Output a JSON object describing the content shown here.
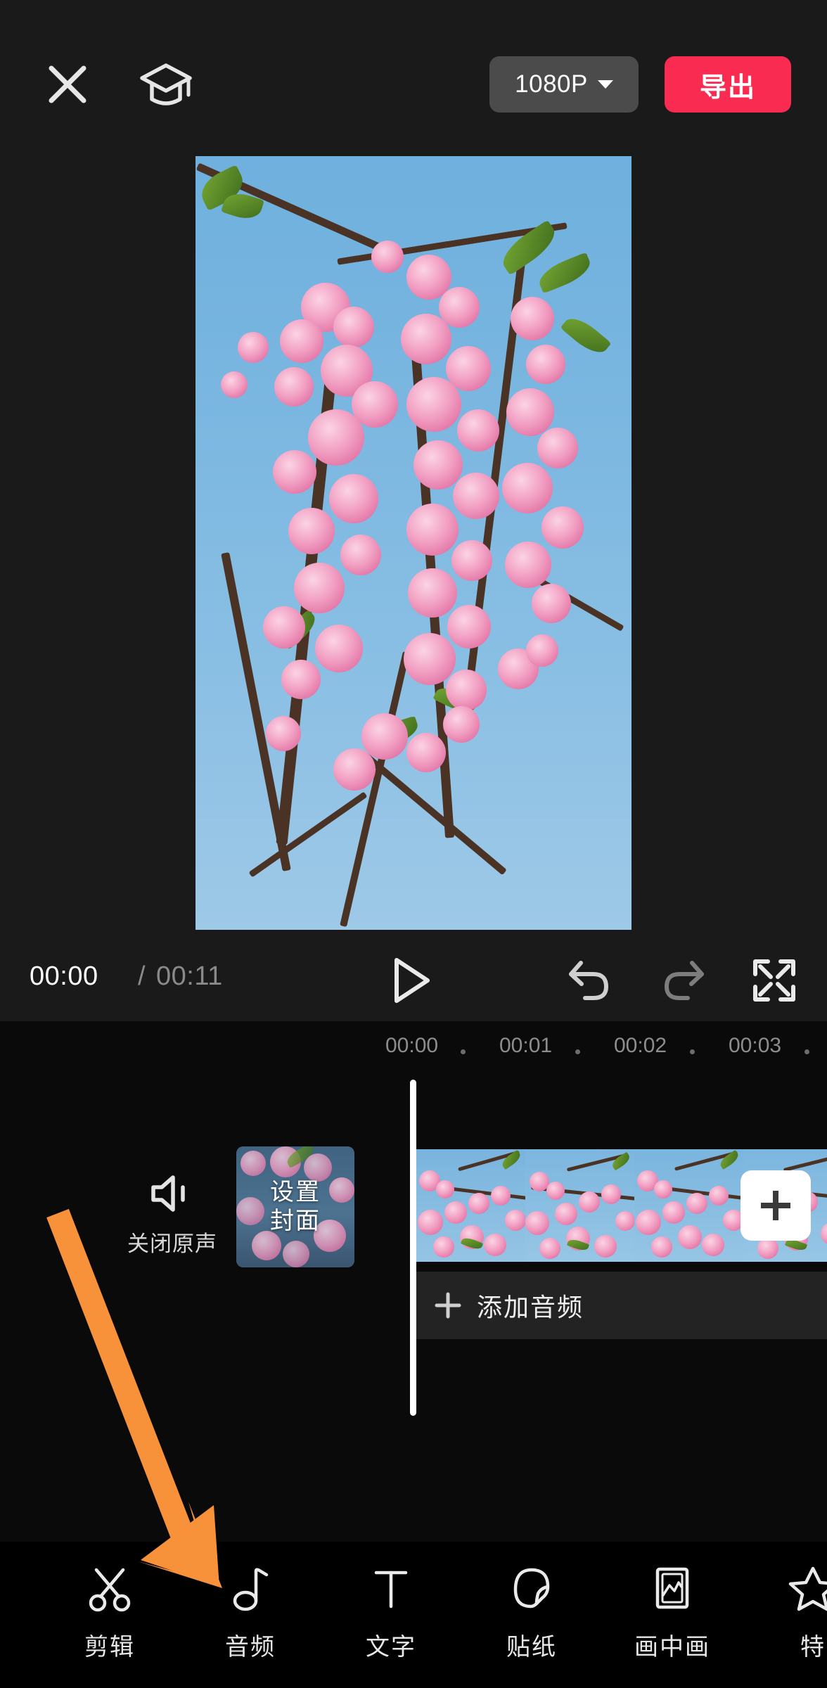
{
  "app": {
    "name": "CapCut Video Editor",
    "accent_red": "#fa2b50",
    "annotation_orange": "#f7913a",
    "bg_upper": "#1a1a1a",
    "bg_timeline": "#0a0a0a"
  },
  "topbar": {
    "close_icon": "close-x-icon",
    "tutorial_icon": "graduation-cap-icon",
    "resolution": {
      "value": "1080P",
      "caret_icon": "chevron-down-icon"
    },
    "export": {
      "label": "导出"
    }
  },
  "preview": {
    "description": "pink cherry blossom branches against blue sky"
  },
  "transport": {
    "current_time": "00:00",
    "separator": "/",
    "total_time": "00:11",
    "play_icon": "play-icon",
    "undo_icon": "undo-icon",
    "redo_icon": "redo-icon",
    "fullscreen_icon": "fullscreen-icon"
  },
  "timeline": {
    "ruler_labels": [
      "00:00",
      "00:01",
      "00:02",
      "00:03"
    ],
    "playhead_position": "00:00",
    "mute_control": {
      "icon": "speaker-icon",
      "label": "关闭原声"
    },
    "cover_thumbnail": {
      "line1": "设置",
      "line2": "封面"
    },
    "add_clip_button": {
      "icon": "plus-icon"
    },
    "audio_track": {
      "icon": "plus-icon",
      "label": "添加音频"
    }
  },
  "bottom_nav": {
    "items": [
      {
        "label": "剪辑",
        "icon": "scissors-icon"
      },
      {
        "label": "音频",
        "icon": "music-note-icon"
      },
      {
        "label": "文字",
        "icon": "text-t-icon"
      },
      {
        "label": "贴纸",
        "icon": "sticker-icon"
      },
      {
        "label": "画中画",
        "icon": "picture-in-picture-icon"
      },
      {
        "label": "特",
        "icon": "star-effects-icon"
      }
    ]
  },
  "annotation": {
    "arrow_color": "#f7913a",
    "points_to": "音频"
  }
}
